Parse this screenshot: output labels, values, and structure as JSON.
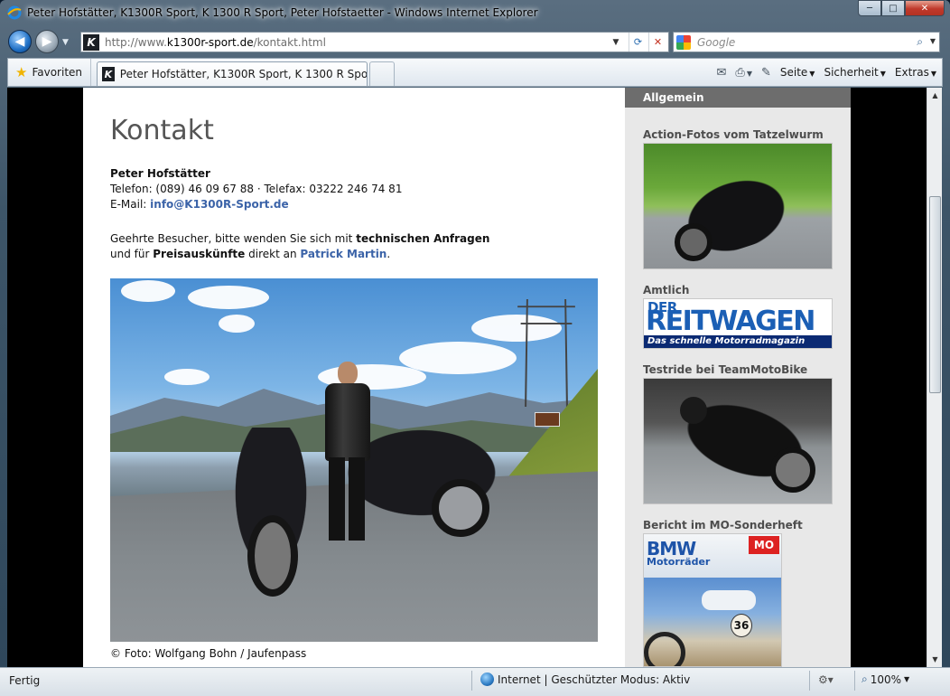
{
  "window": {
    "title": "Peter Hofstätter, K1300R Sport, K 1300 R Sport, Peter Hofstaetter - Windows Internet Explorer",
    "minimize_glyph": "─",
    "maximize_glyph": "□",
    "close_glyph": "✕"
  },
  "address_bar": {
    "url_prefix": "http://www.",
    "url_host": "k1300r-sport.de",
    "url_path": "/kontakt.html",
    "favicon_letter": "K"
  },
  "search": {
    "placeholder": "Google"
  },
  "command_bar": {
    "favorites_label": "Favoriten",
    "tab_label": "Peter Hofstätter, K1300R Sport, K 1300 R Sport, Pe...",
    "tools": [
      {
        "label": "Seite"
      },
      {
        "label": "Sicherheit"
      },
      {
        "label": "Extras"
      }
    ]
  },
  "page": {
    "heading": "Kontakt",
    "contact": {
      "name": "Peter Hofstätter",
      "phone_line": "Telefon: (089) 46 09 67 88 · Telefax: 03222 246 74 81",
      "email_label": "E-Mail:",
      "email": "info@K1300R-Sport.de"
    },
    "intro": {
      "part1": "Geehrte Besucher, bitte wenden Sie sich mit",
      "bold1": "technischen Anfragen",
      "part2": "und für",
      "bold2": "Preisauskünfte",
      "part3": "direkt an",
      "link": "Patrick Martin",
      "end": "."
    },
    "photo_caption": "© Foto: Wolfgang Bohn / Jaufenpass"
  },
  "sidebar": {
    "header": "Allgemein",
    "items": [
      {
        "label": "Action-Fotos vom Tatzelwurm"
      },
      {
        "label": "Amtlich"
      },
      {
        "label": "Testride bei TeamMotoBike"
      },
      {
        "label": "Bericht im MO-Sonderheft"
      }
    ],
    "reitwagen": {
      "der": "DER",
      "big": "REITWAGEN",
      "sub": "Das schnelle Motorradmagazin"
    },
    "magazine": {
      "brand": "BMW",
      "title": "Motorräder",
      "badge": "MO",
      "number": "36"
    }
  },
  "status_bar": {
    "left": "Fertig",
    "zone": "Internet | Geschützter Modus: Aktiv",
    "zoom": "100%"
  },
  "colors": {
    "link": "#3b63a8",
    "sidebar_header_bg": "#6d6d6d",
    "sidebar_bg": "#e8e8e8"
  }
}
